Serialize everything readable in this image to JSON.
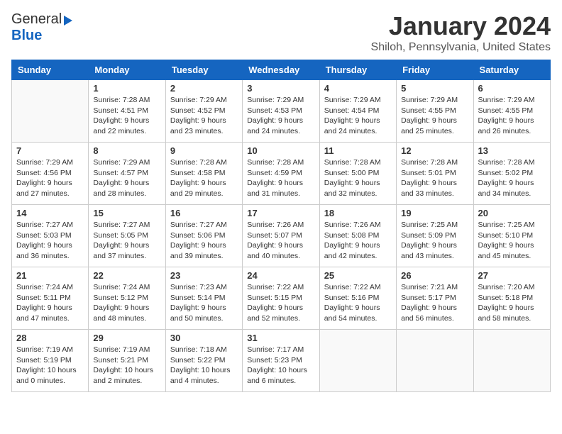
{
  "header": {
    "logo_general": "General",
    "logo_blue": "Blue",
    "title": "January 2024",
    "subtitle": "Shiloh, Pennsylvania, United States"
  },
  "days_of_week": [
    "Sunday",
    "Monday",
    "Tuesday",
    "Wednesday",
    "Thursday",
    "Friday",
    "Saturday"
  ],
  "weeks": [
    [
      {
        "day": "",
        "content": ""
      },
      {
        "day": "1",
        "content": "Sunrise: 7:28 AM\nSunset: 4:51 PM\nDaylight: 9 hours\nand 22 minutes."
      },
      {
        "day": "2",
        "content": "Sunrise: 7:29 AM\nSunset: 4:52 PM\nDaylight: 9 hours\nand 23 minutes."
      },
      {
        "day": "3",
        "content": "Sunrise: 7:29 AM\nSunset: 4:53 PM\nDaylight: 9 hours\nand 24 minutes."
      },
      {
        "day": "4",
        "content": "Sunrise: 7:29 AM\nSunset: 4:54 PM\nDaylight: 9 hours\nand 24 minutes."
      },
      {
        "day": "5",
        "content": "Sunrise: 7:29 AM\nSunset: 4:55 PM\nDaylight: 9 hours\nand 25 minutes."
      },
      {
        "day": "6",
        "content": "Sunrise: 7:29 AM\nSunset: 4:55 PM\nDaylight: 9 hours\nand 26 minutes."
      }
    ],
    [
      {
        "day": "7",
        "content": "Sunrise: 7:29 AM\nSunset: 4:56 PM\nDaylight: 9 hours\nand 27 minutes."
      },
      {
        "day": "8",
        "content": "Sunrise: 7:29 AM\nSunset: 4:57 PM\nDaylight: 9 hours\nand 28 minutes."
      },
      {
        "day": "9",
        "content": "Sunrise: 7:28 AM\nSunset: 4:58 PM\nDaylight: 9 hours\nand 29 minutes."
      },
      {
        "day": "10",
        "content": "Sunrise: 7:28 AM\nSunset: 4:59 PM\nDaylight: 9 hours\nand 31 minutes."
      },
      {
        "day": "11",
        "content": "Sunrise: 7:28 AM\nSunset: 5:00 PM\nDaylight: 9 hours\nand 32 minutes."
      },
      {
        "day": "12",
        "content": "Sunrise: 7:28 AM\nSunset: 5:01 PM\nDaylight: 9 hours\nand 33 minutes."
      },
      {
        "day": "13",
        "content": "Sunrise: 7:28 AM\nSunset: 5:02 PM\nDaylight: 9 hours\nand 34 minutes."
      }
    ],
    [
      {
        "day": "14",
        "content": "Sunrise: 7:27 AM\nSunset: 5:03 PM\nDaylight: 9 hours\nand 36 minutes."
      },
      {
        "day": "15",
        "content": "Sunrise: 7:27 AM\nSunset: 5:05 PM\nDaylight: 9 hours\nand 37 minutes."
      },
      {
        "day": "16",
        "content": "Sunrise: 7:27 AM\nSunset: 5:06 PM\nDaylight: 9 hours\nand 39 minutes."
      },
      {
        "day": "17",
        "content": "Sunrise: 7:26 AM\nSunset: 5:07 PM\nDaylight: 9 hours\nand 40 minutes."
      },
      {
        "day": "18",
        "content": "Sunrise: 7:26 AM\nSunset: 5:08 PM\nDaylight: 9 hours\nand 42 minutes."
      },
      {
        "day": "19",
        "content": "Sunrise: 7:25 AM\nSunset: 5:09 PM\nDaylight: 9 hours\nand 43 minutes."
      },
      {
        "day": "20",
        "content": "Sunrise: 7:25 AM\nSunset: 5:10 PM\nDaylight: 9 hours\nand 45 minutes."
      }
    ],
    [
      {
        "day": "21",
        "content": "Sunrise: 7:24 AM\nSunset: 5:11 PM\nDaylight: 9 hours\nand 47 minutes."
      },
      {
        "day": "22",
        "content": "Sunrise: 7:24 AM\nSunset: 5:12 PM\nDaylight: 9 hours\nand 48 minutes."
      },
      {
        "day": "23",
        "content": "Sunrise: 7:23 AM\nSunset: 5:14 PM\nDaylight: 9 hours\nand 50 minutes."
      },
      {
        "day": "24",
        "content": "Sunrise: 7:22 AM\nSunset: 5:15 PM\nDaylight: 9 hours\nand 52 minutes."
      },
      {
        "day": "25",
        "content": "Sunrise: 7:22 AM\nSunset: 5:16 PM\nDaylight: 9 hours\nand 54 minutes."
      },
      {
        "day": "26",
        "content": "Sunrise: 7:21 AM\nSunset: 5:17 PM\nDaylight: 9 hours\nand 56 minutes."
      },
      {
        "day": "27",
        "content": "Sunrise: 7:20 AM\nSunset: 5:18 PM\nDaylight: 9 hours\nand 58 minutes."
      }
    ],
    [
      {
        "day": "28",
        "content": "Sunrise: 7:19 AM\nSunset: 5:19 PM\nDaylight: 10 hours\nand 0 minutes."
      },
      {
        "day": "29",
        "content": "Sunrise: 7:19 AM\nSunset: 5:21 PM\nDaylight: 10 hours\nand 2 minutes."
      },
      {
        "day": "30",
        "content": "Sunrise: 7:18 AM\nSunset: 5:22 PM\nDaylight: 10 hours\nand 4 minutes."
      },
      {
        "day": "31",
        "content": "Sunrise: 7:17 AM\nSunset: 5:23 PM\nDaylight: 10 hours\nand 6 minutes."
      },
      {
        "day": "",
        "content": ""
      },
      {
        "day": "",
        "content": ""
      },
      {
        "day": "",
        "content": ""
      }
    ]
  ]
}
